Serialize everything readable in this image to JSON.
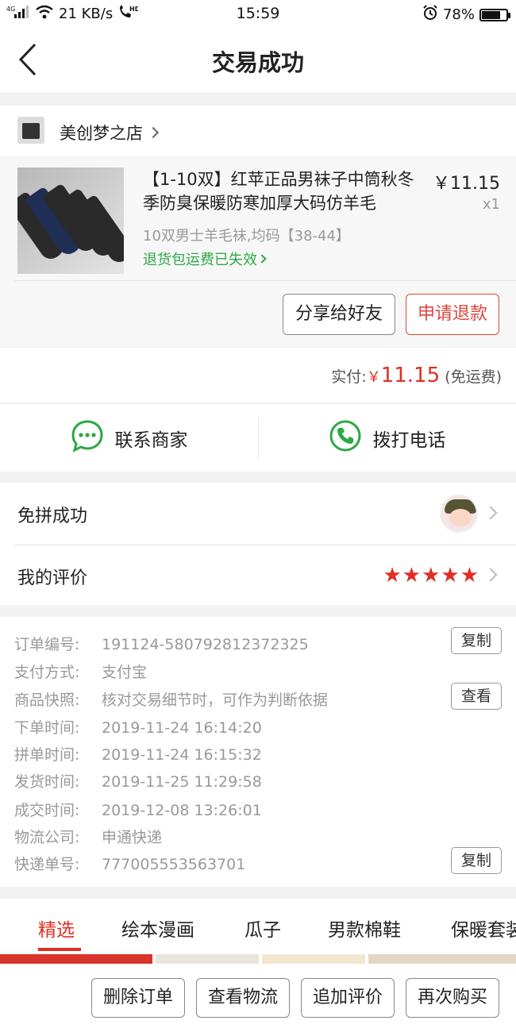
{
  "status_bar": {
    "network_type": "4G",
    "speed": "21 KB/s",
    "hd_label": "HD",
    "time": "15:59",
    "battery": "78%",
    "battery_level": 0.78
  },
  "nav": {
    "back_icon": "chevron-left-icon",
    "title": "交易成功"
  },
  "shop": {
    "name": "美创梦之店"
  },
  "product": {
    "title": "【1-10双】红苹正品男袜子中筒秋冬季防臭保暖防寒加厚大码仿羊毛",
    "price": "￥11.15",
    "quantity": "x1",
    "spec": "10双男士羊毛袜,均码【38-44】",
    "return_note": "退货包运费已失效"
  },
  "actions": {
    "share": "分享给好友",
    "refund": "申请退款"
  },
  "payment": {
    "label": "实付:",
    "currency": "￥",
    "amount": "11.15",
    "shipping": "(免运费)"
  },
  "contact": {
    "merchant": "联系商家",
    "merchant_icon": "chat-bubble-icon",
    "call": "拨打电话",
    "call_icon": "phone-icon"
  },
  "rows": {
    "group_status": "免拼成功",
    "review": "我的评价",
    "review_stars": 5
  },
  "details": [
    {
      "key": "订单编号:",
      "value": "191124-580792812372325",
      "button": "复制"
    },
    {
      "key": "支付方式:",
      "value": "支付宝"
    },
    {
      "key": "商品快照:",
      "value": "核对交易细节时，可作为判断依据",
      "button": "查看"
    },
    {
      "key": "下单时间:",
      "value": "2019-11-24 16:14:20"
    },
    {
      "key": "拼单时间:",
      "value": "2019-11-24 16:15:32"
    },
    {
      "key": "发货时间:",
      "value": "2019-11-25 11:29:58"
    },
    {
      "key": "成交时间:",
      "value": "2019-12-08 13:26:01"
    },
    {
      "key": "物流公司:",
      "value": "申通快递"
    },
    {
      "key": "快递单号:",
      "value": "777005553563701",
      "button": "复制"
    }
  ],
  "tabs": [
    "精选",
    "绘本漫画",
    "瓜子",
    "男款棉鞋",
    "保暖套装"
  ],
  "bottom_actions": [
    "删除订单",
    "查看物流",
    "追加评价",
    "再次购买"
  ],
  "colors": {
    "accent": "#e02e24",
    "green": "#2da844"
  }
}
